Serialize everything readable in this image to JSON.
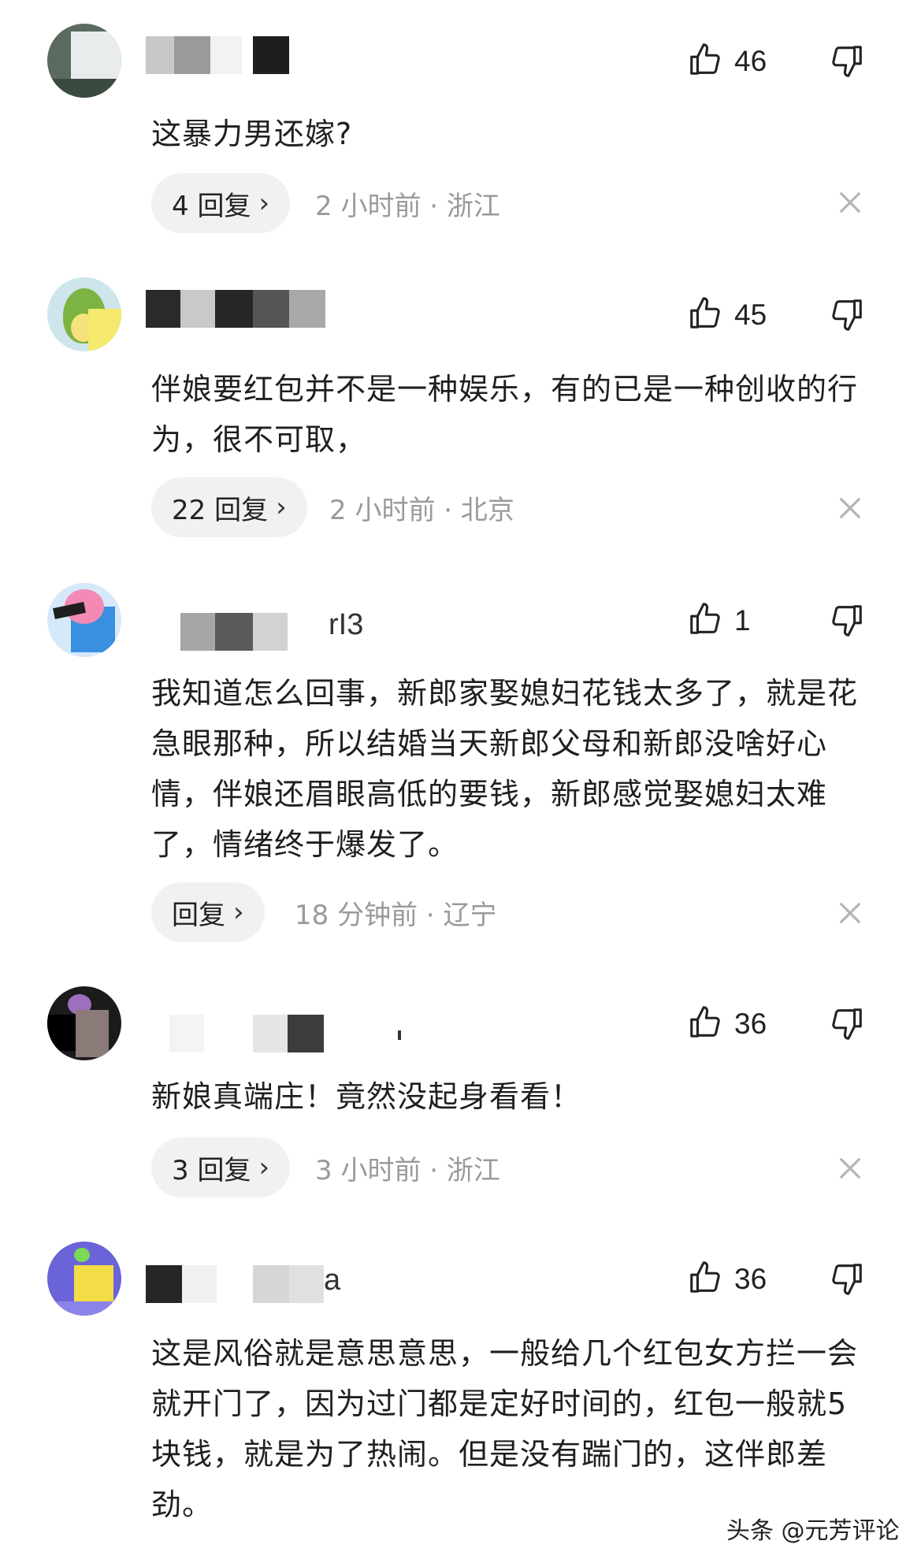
{
  "comments": [
    {
      "likes": "46",
      "text": "这暴力男还嫁?",
      "reply_label": "4 回复",
      "meta": "2 小时前 · 浙江"
    },
    {
      "likes": "45",
      "text": "伴娘要红包并不是一种娱乐，有的已是一种创收的行为，很不可取，",
      "reply_label": "22 回复",
      "meta": "2 小时前 · 北京"
    },
    {
      "likes": "1",
      "name_fragment": "rI3",
      "text": "我知道怎么回事，新郎家娶媳妇花钱太多了，就是花急眼那种，所以结婚当天新郎父母和新郎没啥好心情，伴娘还眉眼高低的要钱，新郎感觉娶媳妇太难了，情绪终于爆发了。",
      "reply_label": "回复",
      "meta": "18 分钟前 · 辽宁"
    },
    {
      "likes": "36",
      "text": "新娘真端庄！竟然没起身看看！",
      "reply_label": "3 回复",
      "meta": "3 小时前 · 浙江"
    },
    {
      "likes": "36",
      "name_fragment": "a",
      "text": "这是风俗就是意思意思，一般给几个红包女方拦一会就开门了，因为过门都是定好时间的，红包一般就5块钱，就是为了热闹。但是没有踹门的，这伴郎差劲。"
    }
  ],
  "chevron": "›",
  "watermark": "头条 @元芳评论",
  "icons": {
    "like": "thumbs-up-icon",
    "dislike": "thumbs-down-icon",
    "close": "close-icon",
    "chevron": "chevron-right-icon"
  },
  "colors": {
    "meta_text": "#9a9a9a",
    "pill_bg": "#f1f1f1"
  }
}
